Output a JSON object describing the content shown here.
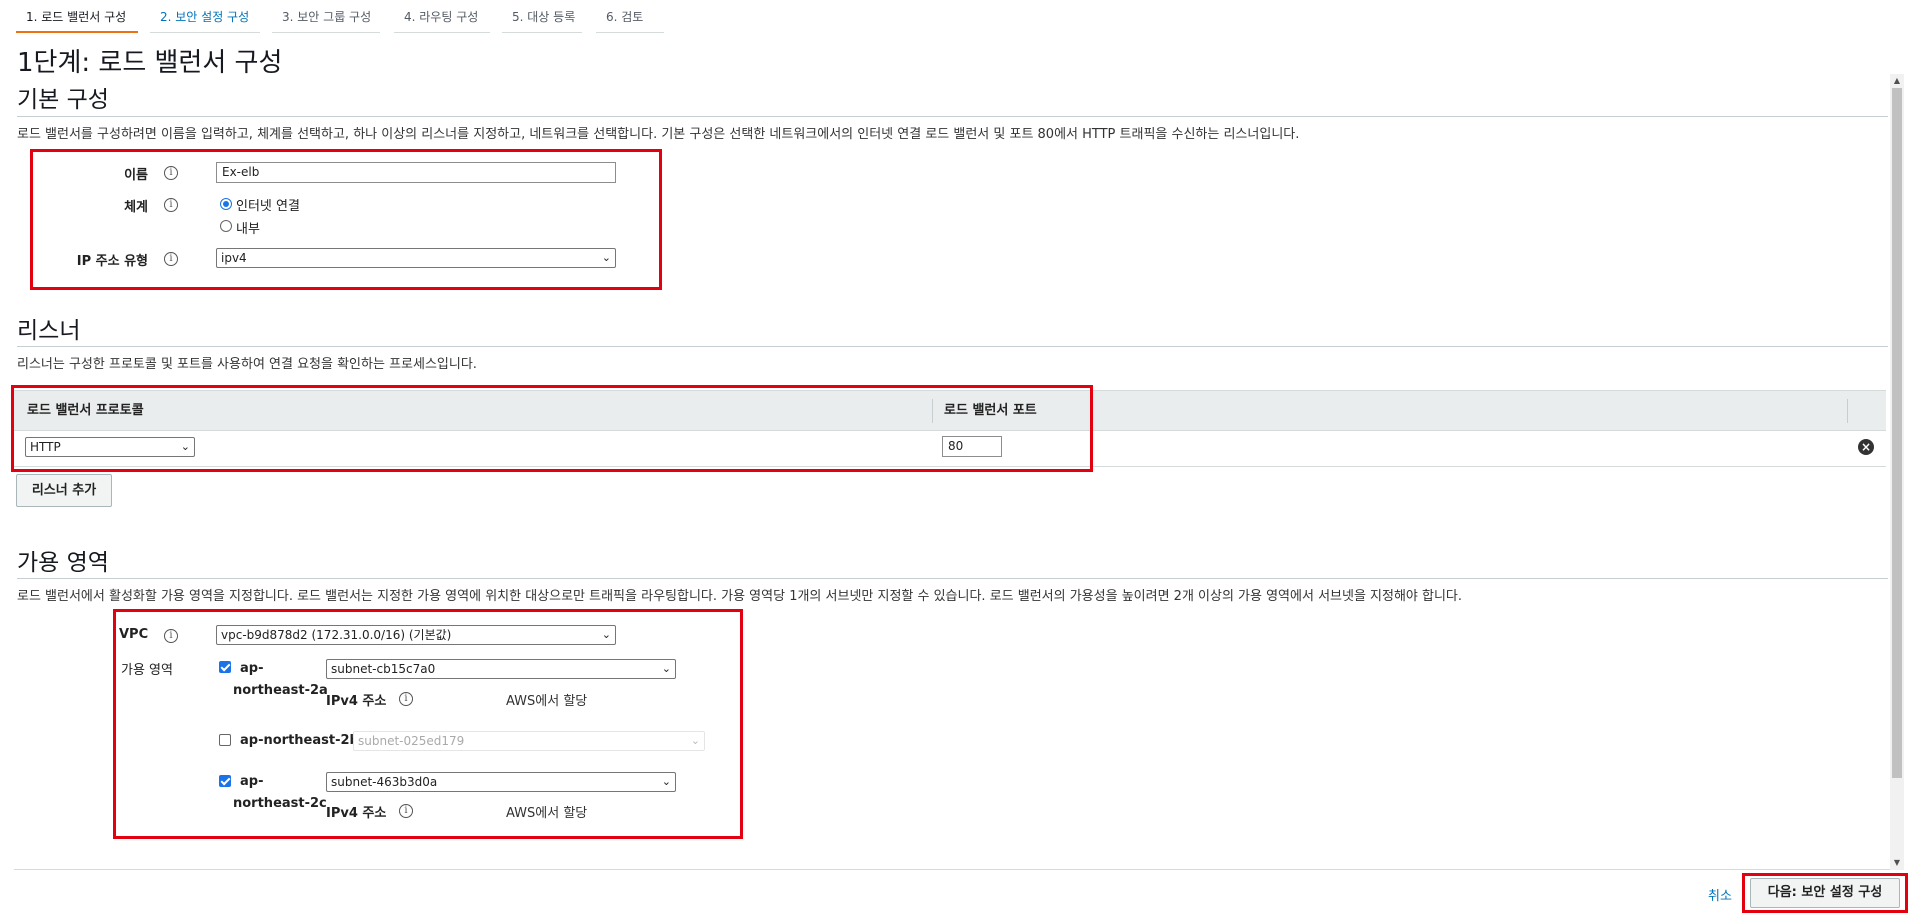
{
  "wizard": {
    "tabs": [
      {
        "label": "1. 로드 밸런서 구성",
        "state": "active"
      },
      {
        "label": "2. 보안 설정 구성",
        "state": "next"
      },
      {
        "label": "3. 보안 그룹 구성",
        "state": "pending"
      },
      {
        "label": "4. 라우팅 구성",
        "state": "pending"
      },
      {
        "label": "5. 대상 등록",
        "state": "pending"
      },
      {
        "label": "6. 검토",
        "state": "pending"
      }
    ]
  },
  "page_title": "1단계: 로드 밸런서 구성",
  "basic": {
    "title": "기본 구성",
    "description": "로드 밸런서를 구성하려면 이름을 입력하고, 체계를 선택하고, 하나 이상의 리스너를 지정하고, 네트워크를 선택합니다. 기본 구성은 선택한 네트워크에서의 인터넷 연결 로드 밸런서 및 포트 80에서 HTTP 트래픽을 수신하는 리스너입니다.",
    "name_label": "이름",
    "name_value": "Ex-elb",
    "scheme_label": "체계",
    "scheme_options": [
      "인터넷 연결",
      "내부"
    ],
    "scheme_selected": "인터넷 연결",
    "ip_label": "IP 주소 유형",
    "ip_value": "ipv4"
  },
  "listeners": {
    "title": "리스너",
    "description": "리스너는 구성한 프로토콜 및 포트를 사용하여 연결 요청을 확인하는 프로세스입니다.",
    "columns": [
      "로드 밸런서 프로토콜",
      "로드 밸런서 포트"
    ],
    "rows": [
      {
        "protocol": "HTTP",
        "port": "80"
      }
    ],
    "add_button": "리스너 추가"
  },
  "az": {
    "title": "가용 영역",
    "description": "로드 밸런서에서 활성화할 가용 영역을 지정합니다. 로드 밸런서는 지정한 가용 영역에 위치한 대상으로만 트래픽을 라우팅합니다. 가용 영역당 1개의 서브넷만 지정할 수 있습니다. 로드 밸런서의 가용성을 높이려면 2개 이상의 가용 영역에서 서브넷을 지정해야 합니다.",
    "vpc_label": "VPC",
    "vpc_value": "vpc-b9d878d2 (172.31.0.0/16) (기본값)",
    "zones_label": "가용 영역",
    "zones": [
      {
        "name_line1": "ap-",
        "name_line2": "northeast-2a",
        "checked": true,
        "subnet": "subnet-cb15c7a0",
        "ipv4_label": "IPv4 주소",
        "ipv4_value": "AWS에서 할당"
      },
      {
        "name": "ap-northeast-2b",
        "checked": false,
        "subnet": "subnet-025ed179"
      },
      {
        "name_line1": "ap-",
        "name_line2": "northeast-2c",
        "checked": true,
        "subnet": "subnet-463b3d0a",
        "ipv4_label": "IPv4 주소",
        "ipv4_value": "AWS에서 할당"
      }
    ]
  },
  "footer": {
    "cancel": "취소",
    "next": "다음: 보안 설정 구성"
  },
  "colors": {
    "accent_tab": "#ec7211",
    "link": "#0073bb",
    "highlight": "#e3000f"
  }
}
